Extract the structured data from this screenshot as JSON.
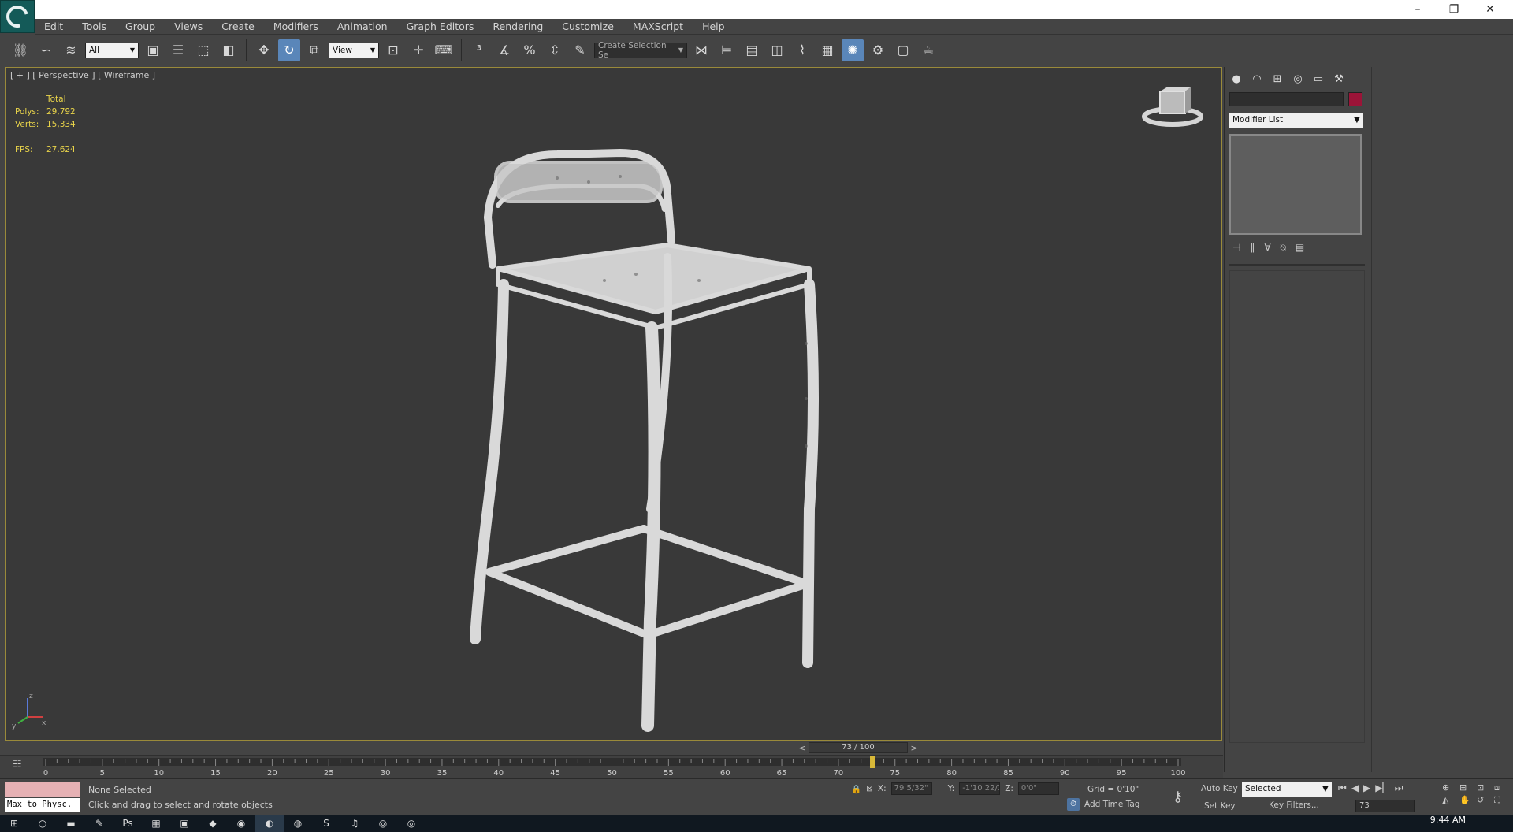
{
  "menu": [
    "Edit",
    "Tools",
    "Group",
    "Views",
    "Create",
    "Modifiers",
    "Animation",
    "Graph Editors",
    "Rendering",
    "Customize",
    "MAXScript",
    "Help"
  ],
  "window_controls": {
    "minimize": "–",
    "restore": "❐",
    "close": "✕"
  },
  "toolbar": {
    "selection_filter": "All",
    "ref_coord": "View",
    "named_selection": "Create Selection Se"
  },
  "viewport": {
    "label": "[ + ] [ Perspective ] [ Wireframe ]",
    "stats": {
      "header": "Total",
      "polys_label": "Polys:",
      "polys": "29,792",
      "verts_label": "Verts:",
      "verts": "15,334",
      "fps_label": "FPS:",
      "fps": "27.624"
    },
    "axis": {
      "x": "x",
      "y": "y",
      "z": "z"
    }
  },
  "command_panel": {
    "modifier_list": "Modifier List",
    "color_swatch": "#9b1438"
  },
  "timeline": {
    "frame_display": "73 / 100",
    "prev": "<",
    "next": ">",
    "ticks": [
      "0",
      "5",
      "10",
      "15",
      "20",
      "25",
      "30",
      "35",
      "40",
      "45",
      "50",
      "55",
      "60",
      "65",
      "70",
      "75",
      "80",
      "85",
      "90",
      "95",
      "100"
    ],
    "current_frame": 73,
    "total_frames": 100
  },
  "status": {
    "listener": "Max to Physc.",
    "selection": "None Selected",
    "prompt": "Click and drag to select and rotate objects",
    "x_label": "X:",
    "x": "79 5/32\"",
    "y_label": "Y:",
    "y": "-1'10 22/32",
    "z_label": "Z:",
    "z": "0'0\"",
    "grid": "Grid = 0'10\"",
    "add_time_tag": "Add Time Tag",
    "auto_key": "Auto Key",
    "set_key": "Set Key",
    "selected_dd": "Selected",
    "key_filters": "Key Filters...",
    "frame_field": "73"
  },
  "taskbar": {
    "clock": "9:44 AM"
  }
}
